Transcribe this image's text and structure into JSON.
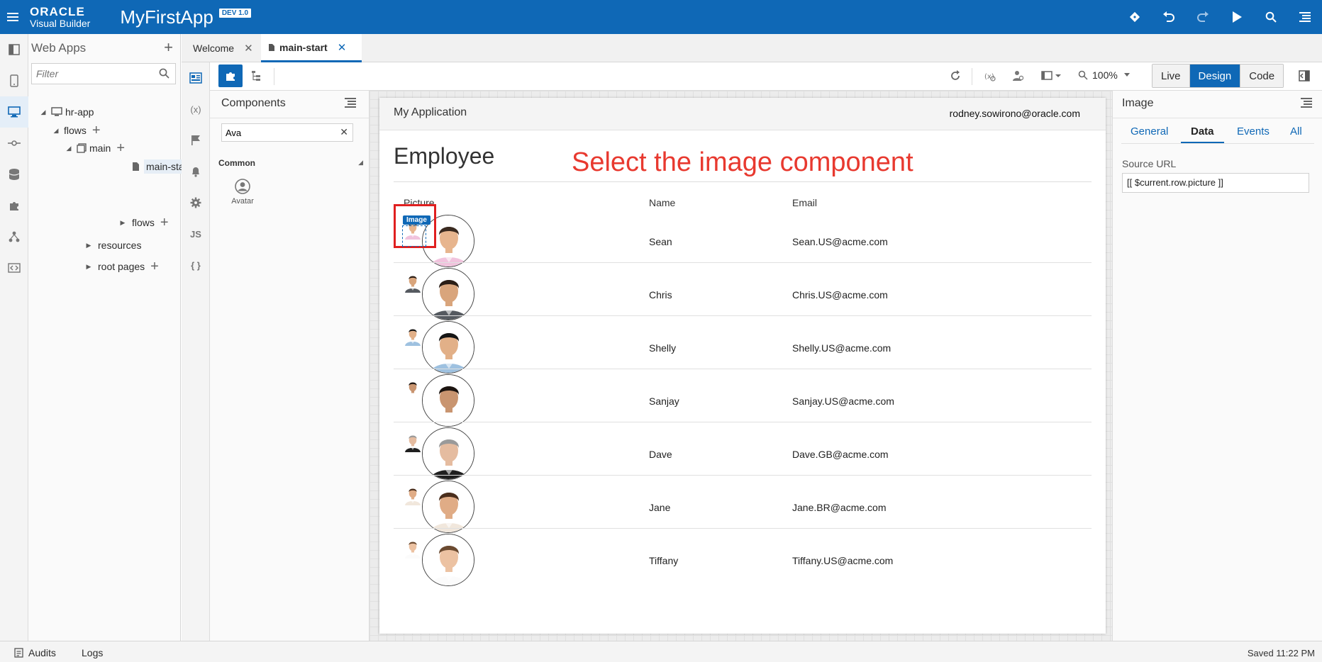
{
  "header": {
    "logo_line1": "ORACLE",
    "logo_line2": "Visual Builder",
    "app_name": "MyFirstApp",
    "badge": "DEV 1.0",
    "actions": [
      "git-icon",
      "undo-icon",
      "redo-icon",
      "run-icon",
      "search-icon",
      "menu-icon"
    ]
  },
  "rail": {
    "items": [
      "navigator-icon",
      "mobile-icon",
      "web-apps-icon",
      "services-icon",
      "business-objects-icon",
      "components-icon",
      "process-icon",
      "source-icon"
    ],
    "active": "web-apps-icon"
  },
  "navigator": {
    "title": "Web Apps",
    "filter_placeholder": "Filter",
    "tree": [
      {
        "label": "hr-app"
      },
      {
        "label": "flows"
      },
      {
        "label": "main"
      },
      {
        "label": "main-start"
      },
      {
        "label": "flows"
      },
      {
        "label": "resources"
      },
      {
        "label": "root pages"
      }
    ]
  },
  "tabs": [
    {
      "label": "Welcome"
    },
    {
      "label": "main-start"
    }
  ],
  "rail2": {
    "items": [
      "page-designer-icon",
      "variables-icon",
      "actions-icon",
      "events-icon",
      "settings-icon",
      "js-icon",
      "json-icon"
    ],
    "labels": {
      "variables": "(x)",
      "js": "JS",
      "json": "{ }"
    }
  },
  "toolbar": {
    "zoom": "100%",
    "modes": [
      "Live",
      "Design",
      "Code"
    ],
    "active_mode": "Design"
  },
  "palette": {
    "title": "Components",
    "search_value": "Ava",
    "section": "Common",
    "items": [
      {
        "label": "Avatar"
      }
    ]
  },
  "page": {
    "app_title": "My Application",
    "user": "rodney.sowirono@oracle.com",
    "title": "Employee",
    "annotation": "Select the image component",
    "selected_tag": "Image",
    "columns": [
      "Picture",
      "Name",
      "Email"
    ],
    "rows": [
      {
        "name": "Sean",
        "email": "Sean.US@acme.com"
      },
      {
        "name": "Chris",
        "email": "Chris.US@acme.com"
      },
      {
        "name": "Shelly",
        "email": "Shelly.US@acme.com"
      },
      {
        "name": "Sanjay",
        "email": "Sanjay.US@acme.com"
      },
      {
        "name": "Dave",
        "email": "Dave.GB@acme.com"
      },
      {
        "name": "Jane",
        "email": "Jane.BR@acme.com"
      },
      {
        "name": "Tiffany",
        "email": "Tiffany.US@acme.com"
      }
    ]
  },
  "properties": {
    "title": "Image",
    "tabs": [
      "General",
      "Data",
      "Events",
      "All"
    ],
    "active_tab": "Data",
    "source_url_label": "Source URL",
    "source_url_value": "[[ $current.row.picture ]]"
  },
  "footer": {
    "audits": "Audits",
    "logs": "Logs",
    "status": "Saved 11:22 PM"
  },
  "colors": {
    "brand": "#0f68b6",
    "annotation": "#e8392f",
    "selection": "#e02020"
  }
}
